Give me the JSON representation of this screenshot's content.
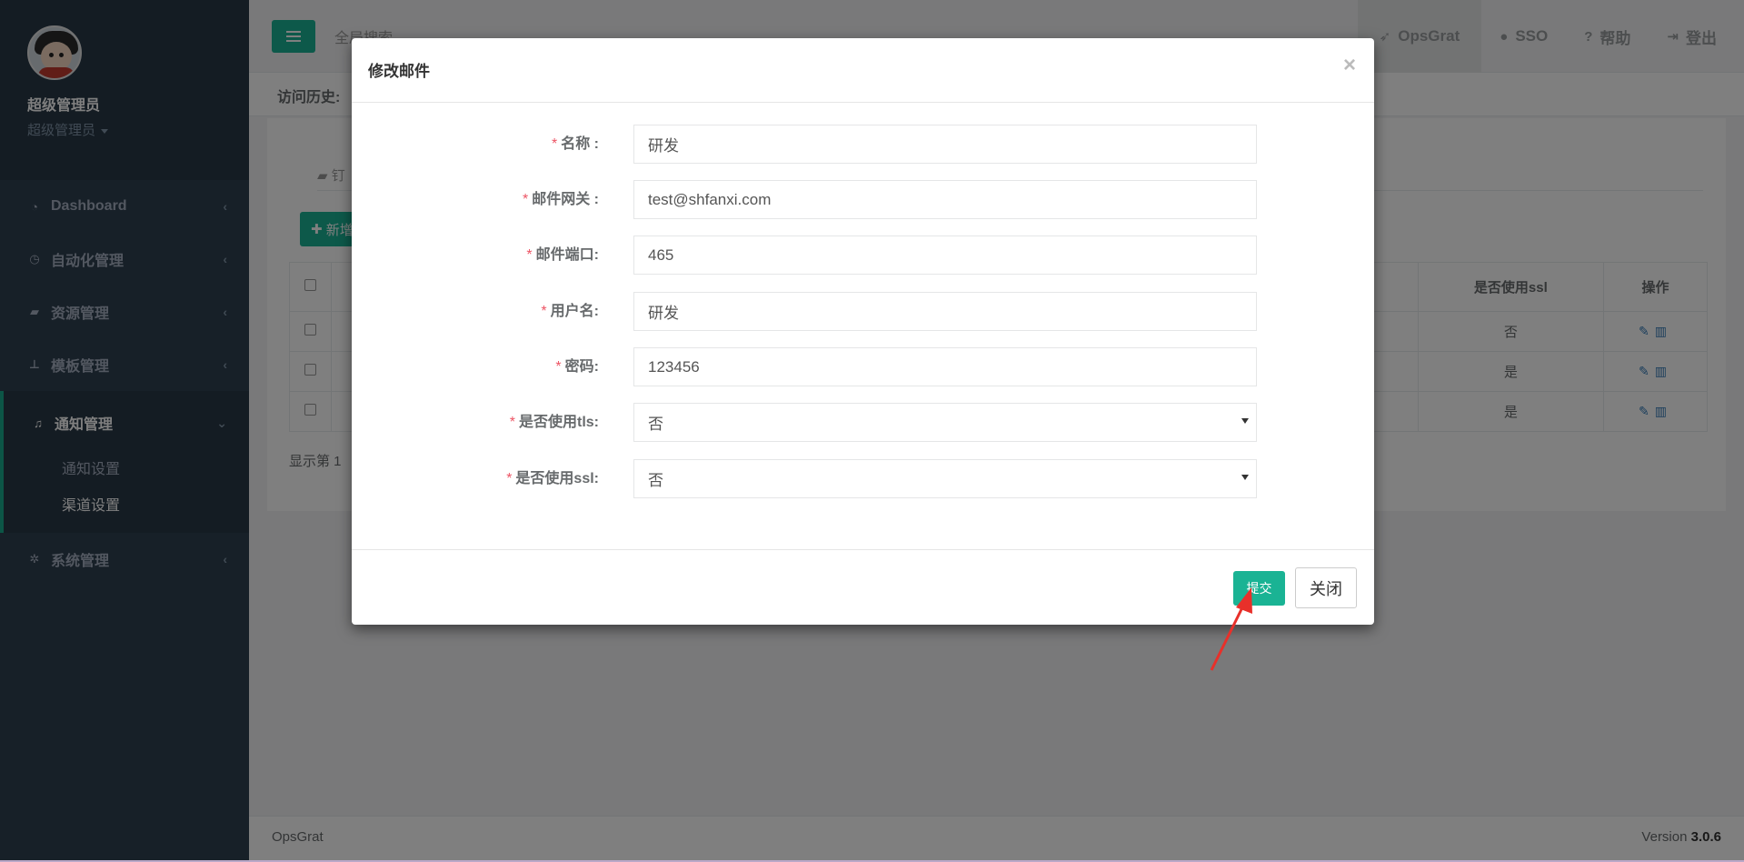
{
  "sidebar": {
    "user_name": "超级管理员",
    "user_role": "超级管理员",
    "items": [
      {
        "label": "Dashboard",
        "icon": "dashboard-icon"
      },
      {
        "label": "自动化管理",
        "icon": "clock-icon"
      },
      {
        "label": "资源管理",
        "icon": "book-icon"
      },
      {
        "label": "模板管理",
        "icon": "sitemap-icon"
      },
      {
        "label": "通知管理",
        "icon": "bell-icon"
      },
      {
        "label": "系统管理",
        "icon": "gear-icon"
      }
    ],
    "sub_items": [
      {
        "label": "通知设置"
      },
      {
        "label": "渠道设置"
      }
    ]
  },
  "topbar": {
    "search_placeholder": "全局搜索",
    "nav": [
      {
        "label": "OpsGrat",
        "icon": "rocket-icon"
      },
      {
        "label": "SSO",
        "icon": "user-icon"
      },
      {
        "label": "帮助",
        "icon": "question-icon"
      },
      {
        "label": "登出",
        "icon": "sign-out-icon"
      }
    ]
  },
  "history": {
    "label": "访问历史:"
  },
  "content": {
    "tab_label": "钉",
    "add_label": "新增",
    "table": {
      "headers": {
        "ssl": "是否使用ssl",
        "actions": "操作"
      },
      "rows": [
        {
          "ssl": "否"
        },
        {
          "ssl": "是"
        },
        {
          "ssl": "是"
        }
      ]
    },
    "show_info": "显示第 1"
  },
  "modal": {
    "title": "修改邮件",
    "close_symbol": "×",
    "fields": [
      {
        "label": "名称 :",
        "value": "研发"
      },
      {
        "label": "邮件网关 :",
        "value": "test@shfanxi.com"
      },
      {
        "label": "邮件端口:",
        "value": "465"
      },
      {
        "label": "用户名:",
        "value": "研发"
      },
      {
        "label": "密码:",
        "value": "123456"
      },
      {
        "label": "是否使用tls:",
        "value": "否"
      },
      {
        "label": "是否使用ssl:",
        "value": "否"
      }
    ],
    "submit_label": "提交",
    "close_label": "关闭"
  },
  "footer": {
    "brand": "OpsGrat",
    "version_prefix": "Version ",
    "version": "3.0.6"
  },
  "colors": {
    "accent": "#1ab394",
    "sidebar": "#2f4050",
    "required": "#ed5565",
    "annotation_arrow": "#e8302a"
  }
}
